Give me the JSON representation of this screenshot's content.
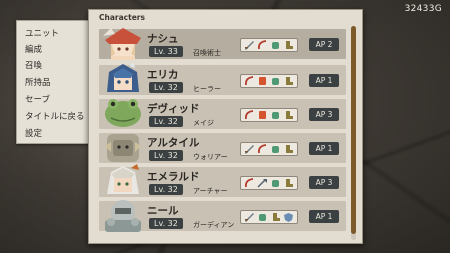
{
  "currency": {
    "amount": "32433G"
  },
  "menu": {
    "items": [
      {
        "label": "ユニット"
      },
      {
        "label": "編成"
      },
      {
        "label": "召喚"
      },
      {
        "label": "所持品"
      },
      {
        "label": "セーブ"
      },
      {
        "label": "タイトルに戻る"
      },
      {
        "label": "設定"
      }
    ]
  },
  "panel": {
    "title": "Characters",
    "characters": [
      {
        "name": "ナシュ",
        "level": "Lv. 33",
        "class": "召喚術士",
        "ap": "AP 2",
        "equipment": [
          "sword-icon",
          "bow-icon",
          "glove-icon",
          "boot-icon"
        ]
      },
      {
        "name": "エリカ",
        "level": "Lv. 32",
        "class": "ヒーラー",
        "ap": "AP 1",
        "equipment": [
          "staff-icon",
          "shield-icon",
          "glove-icon",
          "boot-icon"
        ]
      },
      {
        "name": "デヴィッド",
        "level": "Lv. 32",
        "class": "メイジ",
        "ap": "AP 3",
        "equipment": [
          "staff-icon",
          "shield-icon",
          "glove-icon",
          "boot-icon"
        ]
      },
      {
        "name": "アルタイル",
        "level": "Lv. 32",
        "class": "ウォリアー",
        "ap": "AP 1",
        "equipment": [
          "sword-icon",
          "bow-icon",
          "glove-icon",
          "boot-icon"
        ]
      },
      {
        "name": "エメラルド",
        "level": "Lv. 32",
        "class": "アーチャー",
        "ap": "AP 3",
        "equipment": [
          "bow-icon",
          "arrow-icon",
          "glove-icon",
          "boot-icon"
        ]
      },
      {
        "name": "ニール",
        "level": "Lv. 32",
        "class": "ガーディアン",
        "ap": "AP 1",
        "equipment": [
          "sword-icon",
          "glove-icon",
          "boot-icon",
          "shield-icon"
        ]
      }
    ]
  },
  "colors": {
    "panel_bg": "#e3ddd1",
    "row_bg": "#c8c1b4",
    "row_selected": "#b5ad9f",
    "badge_bg": "#3b4142",
    "scroll_thumb": "#7d5a2a"
  }
}
